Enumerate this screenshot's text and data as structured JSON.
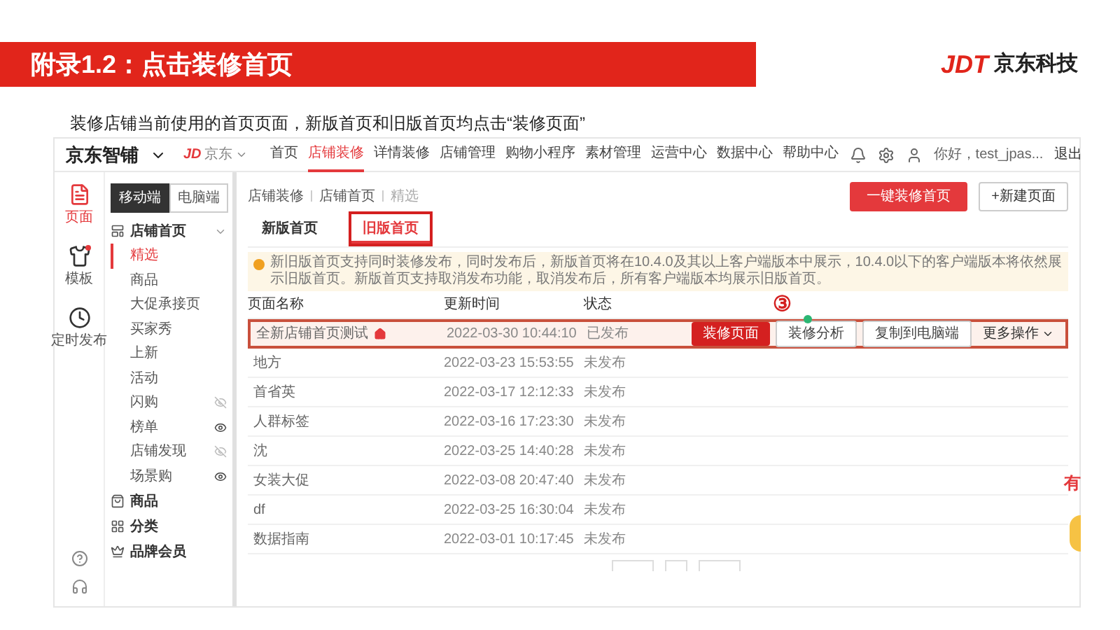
{
  "slide": {
    "title": "附录1.2：点击装修首页",
    "brand_mark": "JDT",
    "brand_name": "京东科技",
    "subtitle": "装修店铺当前使用的首页页面，新版首页和旧版首页均点击“装修页面”",
    "step": "③"
  },
  "app": {
    "logo": "京东智铺",
    "platform_mark": "JD",
    "platform": "京东",
    "nav": [
      {
        "label": "首页",
        "selected": false
      },
      {
        "label": "店铺装修",
        "selected": true
      },
      {
        "label": "详情装修",
        "selected": false
      },
      {
        "label": "店铺管理",
        "selected": false
      },
      {
        "label": "购物小程序",
        "selected": false
      },
      {
        "label": "素材管理",
        "selected": false
      },
      {
        "label": "运营中心",
        "selected": false
      },
      {
        "label": "数据中心",
        "selected": false
      },
      {
        "label": "帮助中心",
        "selected": false
      }
    ],
    "user": "你好，test_jpas...",
    "logout": "退出",
    "rail": [
      {
        "label": "页面",
        "selected": true,
        "badge": false
      },
      {
        "label": "模板",
        "selected": false,
        "badge": true
      },
      {
        "label": "定时发布",
        "selected": false,
        "badge": false
      }
    ],
    "device_tabs": [
      {
        "label": "移动端",
        "selected": true
      },
      {
        "label": "电脑端",
        "selected": false
      }
    ],
    "tree": [
      {
        "label": "店铺首页",
        "kind": "page",
        "expanded": true,
        "children": [
          {
            "label": "精选",
            "selected": true
          },
          {
            "label": "商品",
            "selected": false
          },
          {
            "label": "大促承接页",
            "selected": false
          },
          {
            "label": "买家秀",
            "selected": false
          },
          {
            "label": "上新",
            "selected": false
          },
          {
            "label": "活动",
            "selected": false
          },
          {
            "label": "闪购",
            "selected": false,
            "visible": false
          },
          {
            "label": "榜单",
            "selected": false,
            "visible": true
          },
          {
            "label": "店铺发现",
            "selected": false,
            "visible": false
          },
          {
            "label": "场景购",
            "selected": false,
            "visible": true
          }
        ]
      },
      {
        "label": "商品",
        "kind": "goods"
      },
      {
        "label": "分类",
        "kind": "category"
      },
      {
        "label": "品牌会员",
        "kind": "member"
      }
    ],
    "breadcrumb": [
      "店铺装修",
      "店铺首页",
      "精选"
    ],
    "primary_action": "一键装修首页",
    "secondary_action": "+新建页面",
    "page_tabs": [
      {
        "label": "新版首页",
        "selected": false
      },
      {
        "label": "旧版首页",
        "selected": true
      }
    ],
    "notice": "新旧版首页支持同时装修发布，同时发布后，新版首页将在10.4.0及其以上客户端版本中展示，10.4.0以下的客户端版本将依然展示旧版首页。新版首页支持取消发布功能，取消发布后，所有客户端版本均展示旧版首页。",
    "columns": [
      "页面名称",
      "更新时间",
      "状态"
    ],
    "rows": [
      {
        "name": "全新店铺首页测试",
        "updated": "2022-03-30 10:44:10",
        "status": "已发布",
        "home": true,
        "selected": true,
        "actions": [
          {
            "label": "装修页面",
            "kind": "primary"
          },
          {
            "label": "装修分析",
            "kind": "default"
          },
          {
            "label": "复制到电脑端",
            "kind": "default"
          },
          {
            "label": "更多操作",
            "kind": "menu"
          }
        ]
      },
      {
        "name": "地方",
        "updated": "2022-03-23 15:53:55",
        "status": "未发布",
        "home": false,
        "selected": false
      },
      {
        "name": "首省英",
        "updated": "2022-03-17 12:12:33",
        "status": "未发布",
        "home": false,
        "selected": false
      },
      {
        "name": "人群标签",
        "updated": "2022-03-16 17:23:30",
        "status": "未发布",
        "home": false,
        "selected": false
      },
      {
        "name": "沈",
        "updated": "2022-03-25 14:40:28",
        "status": "未发布",
        "home": false,
        "selected": false
      },
      {
        "name": "女装大促",
        "updated": "2022-03-08 20:47:40",
        "status": "未发布",
        "home": false,
        "selected": false
      },
      {
        "name": "df",
        "updated": "2022-03-25 16:30:04",
        "status": "未发布",
        "home": false,
        "selected": false
      },
      {
        "name": "数据指南",
        "updated": "2022-03-01 10:17:45",
        "status": "未发布",
        "home": false,
        "selected": false
      }
    ],
    "float_label": "有"
  }
}
